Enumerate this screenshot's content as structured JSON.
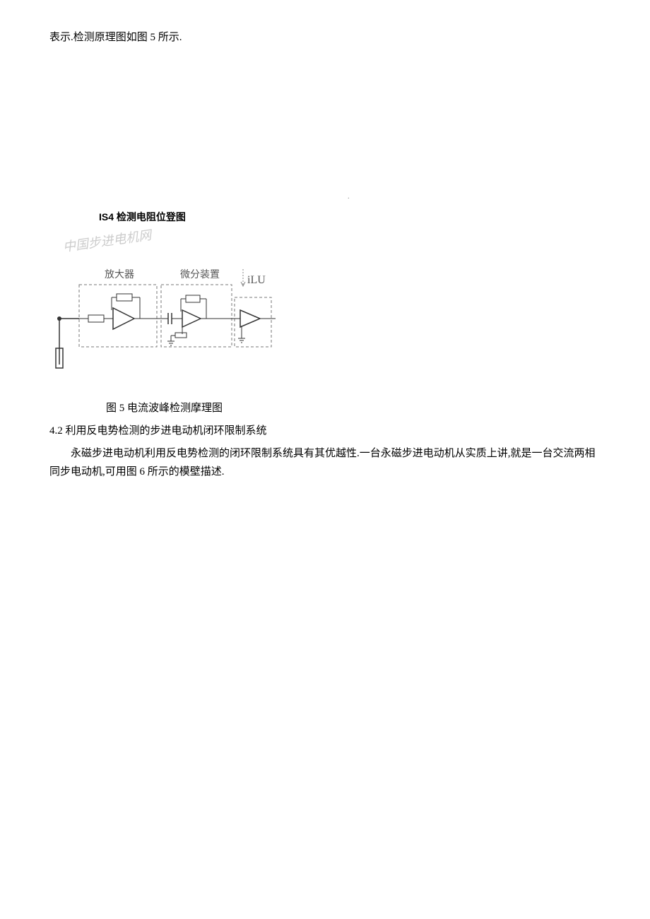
{
  "line1": "表示.检测原理图如图 5 所示.",
  "small_mark": "·",
  "fig_label": "IS4 检测电阻位登图",
  "circuit_labels": {
    "watermark": "中国步进电机网",
    "amp": "放大器",
    "diff": "微分装置",
    "ilu": "iLU"
  },
  "caption": "图 5 电流波峰检测摩理图",
  "section_heading": "4.2  利用反电势检测的步进电动机闭环限制系统",
  "body1": "永磁步进电动机利用反电势检测的闭环限制系统具有其优越性.一台永磁步进电动机从实质上讲,就是一台交流两相",
  "body2": "同步电动机,可用图 6 所示的模壁描述."
}
